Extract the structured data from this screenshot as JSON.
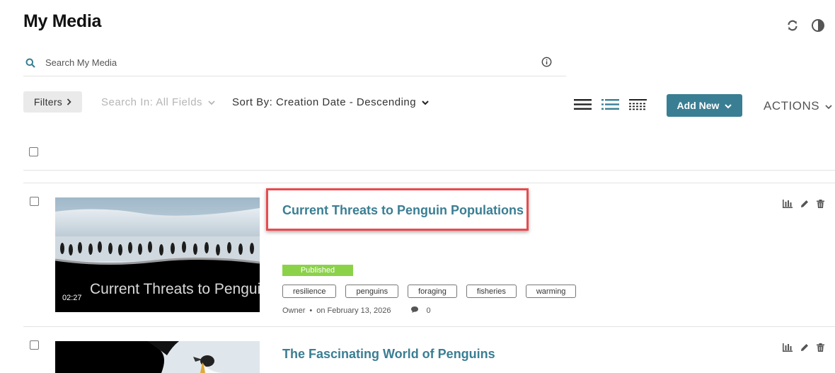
{
  "header": {
    "title": "My Media",
    "icons": [
      "refresh-icon",
      "contrast-icon"
    ]
  },
  "search": {
    "placeholder": "Search My Media",
    "icon": "search-icon",
    "info_icon": "info-icon"
  },
  "toolbar": {
    "filters_label": "Filters",
    "search_in_label": "Search In: All Fields",
    "sort_by_label": "Sort By: Creation Date - Descending",
    "view_icons": [
      "list-view-icon",
      "detailed-view-icon",
      "collapsed-view-icon"
    ],
    "add_new_label": "Add New",
    "actions_label": "ACTIONS"
  },
  "colors": {
    "accent": "#3a7e93",
    "published": "#8bd249",
    "highlight": "#e94a4f"
  },
  "entries": [
    {
      "title": "Current Threats to Penguin Populations",
      "duration": "02:27",
      "thumbnail_caption": "Current Threats to Penguin Populations",
      "status": "Published",
      "tags": [
        "resilience",
        "penguins",
        "foraging",
        "fisheries",
        "warming"
      ],
      "owner_label": "Owner",
      "date_label": "on February 13, 2026",
      "comments": "0"
    },
    {
      "title": "The Fascinating World of Penguins"
    }
  ],
  "row_action_icons": [
    "analytics-icon",
    "edit-icon",
    "delete-icon"
  ]
}
